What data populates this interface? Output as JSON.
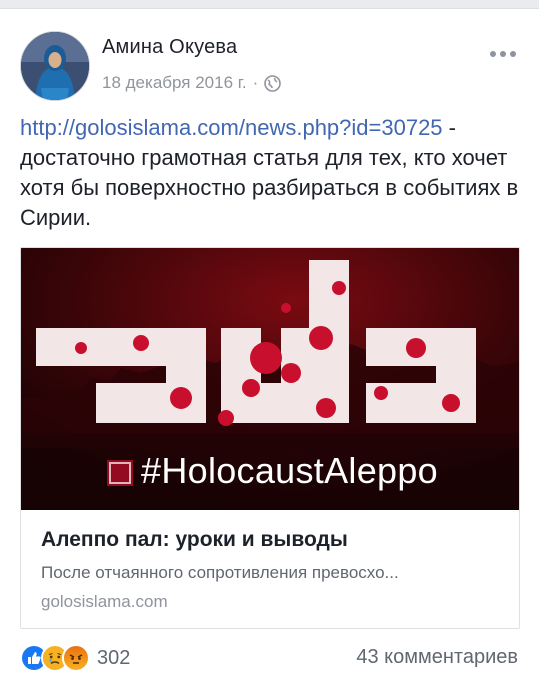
{
  "post": {
    "author": "Амина Окуева",
    "date": "18 декабря 2016 г.",
    "separator": "·",
    "privacy_icon": "globe-icon",
    "link_text": "http://golosislama.com/news.php?id=30725",
    "body_text": " - достаточно грамотная статья для тех, кто хочет хотя бы поверхностно разбираться в событиях в Сирии."
  },
  "link_preview": {
    "image_hashtag": "#HolocaustAleppo",
    "title": "Алеппо пал: уроки и выводы",
    "description": "После отчаянного сопротивления превосхо...",
    "domain": "golosislama.com"
  },
  "footer": {
    "reaction_icons": [
      "like-icon",
      "sad-icon",
      "angry-icon"
    ],
    "reaction_count": "302",
    "comments": "43 комментариев"
  },
  "colors": {
    "link": "#4267b2",
    "like": "#1877f2",
    "reaction_yellow": "#f7b125",
    "angry": "#e9710f",
    "image_red": "#c8102e"
  }
}
